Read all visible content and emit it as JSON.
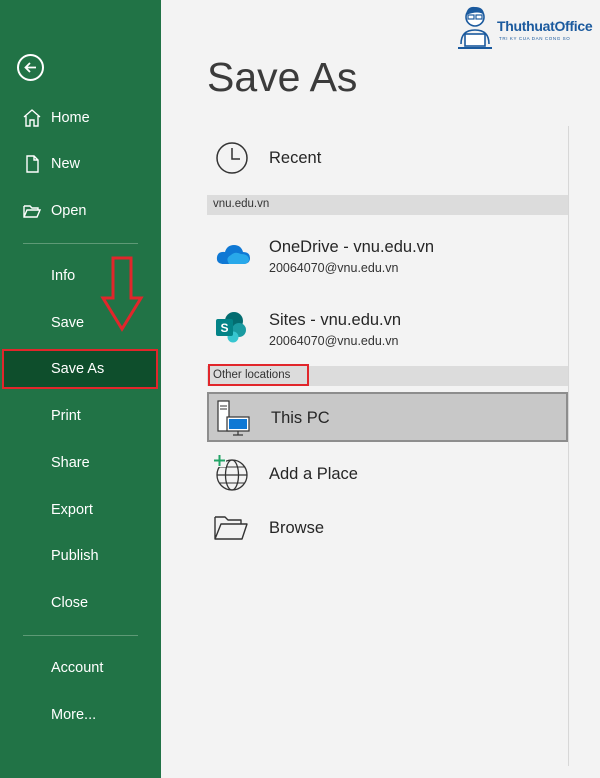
{
  "sidebar": {
    "items": [
      {
        "label": "Home",
        "icon": "home-icon"
      },
      {
        "label": "New",
        "icon": "new-document-icon"
      },
      {
        "label": "Open",
        "icon": "folder-open-icon"
      },
      {
        "label": "Info"
      },
      {
        "label": "Save"
      },
      {
        "label": "Save As",
        "selected": true
      },
      {
        "label": "Print"
      },
      {
        "label": "Share"
      },
      {
        "label": "Export"
      },
      {
        "label": "Publish"
      },
      {
        "label": "Close"
      },
      {
        "label": "Account"
      },
      {
        "label": "More..."
      }
    ]
  },
  "main": {
    "title": "Save As",
    "recent_label": "Recent",
    "section_vnu": "vnu.edu.vn",
    "onedrive": {
      "title": "OneDrive - vnu.edu.vn",
      "subtitle": "20064070@vnu.edu.vn"
    },
    "sites": {
      "title": "Sites - vnu.edu.vn",
      "subtitle": "20064070@vnu.edu.vn"
    },
    "section_other": "Other locations",
    "this_pc": "This PC",
    "add_place": "Add a Place",
    "browse": "Browse"
  },
  "watermark": {
    "name": "ThuthuatOffice",
    "tagline": "TRI KY CUA DAN CONG SO"
  },
  "colors": {
    "sidebar_bg": "#217346",
    "selected_bg": "#0e4e2c",
    "highlight_red": "#e1262b",
    "onedrive_blue": "#0f78d4",
    "sharepoint_teal": "#038387"
  }
}
